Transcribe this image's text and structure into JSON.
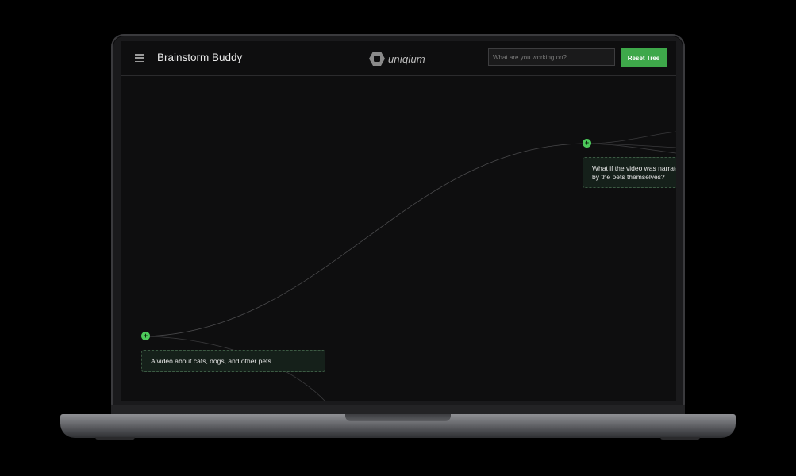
{
  "app": {
    "title": "Brainstorm Buddy",
    "logo_text": "uniqium"
  },
  "header": {
    "menu_icon": "hamburger-menu-icon",
    "search": {
      "placeholder": "What are you working on?",
      "value": ""
    },
    "reset_button_label": "Reset Tree"
  },
  "tree": {
    "nodes": [
      {
        "id": "root",
        "text": "A video about cats, dogs, and other pets"
      },
      {
        "id": "child-1",
        "text": "What if the video was narrated by the pets themselves?"
      }
    ],
    "add_button_icon": "plus-icon"
  },
  "colors": {
    "accent": "#3ea84a",
    "node_dot": "#4cc95a",
    "screen_bg": "#0e0e0f",
    "node_bg": "#15201a"
  }
}
